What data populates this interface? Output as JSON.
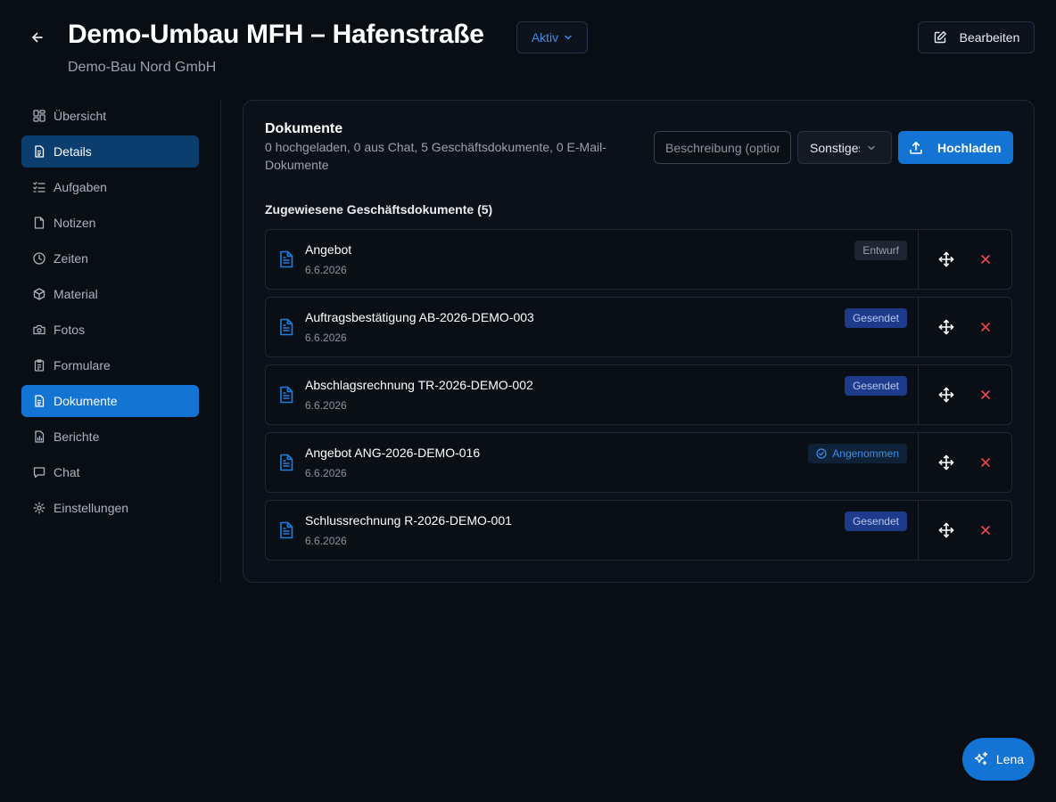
{
  "header": {
    "title": "Demo-Umbau MFH – Hafenstraße",
    "subtitle": "Demo-Bau Nord GmbH",
    "status_label": "Aktiv",
    "edit_label": "Bearbeiten"
  },
  "sidebar": {
    "items": [
      {
        "label": "Übersicht",
        "icon": "dashboard-icon"
      },
      {
        "label": "Details",
        "icon": "document-icon"
      },
      {
        "label": "Aufgaben",
        "icon": "checklist-icon"
      },
      {
        "label": "Notizen",
        "icon": "note-icon"
      },
      {
        "label": "Zeiten",
        "icon": "clock-icon"
      },
      {
        "label": "Material",
        "icon": "box-icon"
      },
      {
        "label": "Fotos",
        "icon": "camera-icon"
      },
      {
        "label": "Formulare",
        "icon": "clipboard-icon"
      },
      {
        "label": "Dokumente",
        "icon": "document-icon"
      },
      {
        "label": "Berichte",
        "icon": "report-icon"
      },
      {
        "label": "Chat",
        "icon": "chat-icon"
      },
      {
        "label": "Einstellungen",
        "icon": "gear-icon"
      }
    ],
    "hover_item": "Details",
    "active_item": "Dokumente"
  },
  "documents": {
    "title": "Dokumente",
    "summary": "0 hochgeladen, 0 aus Chat, 5 Geschäftsdokumente, 0 E-Mail-Dokumente",
    "description_placeholder": "Beschreibung (optional)",
    "type_selected": "Sonstiges",
    "upload_label": "Hochladen",
    "section_title": "Zugewiesene Geschäftsdokumente (5)",
    "items": [
      {
        "name": "Angebot",
        "date": "6.6.2026",
        "status": "Entwurf",
        "status_kind": "draft"
      },
      {
        "name": "Auftragsbestätigung AB-2026-DEMO-003",
        "date": "6.6.2026",
        "status": "Gesendet",
        "status_kind": "sent"
      },
      {
        "name": "Abschlagsrechnung TR-2026-DEMO-002",
        "date": "6.6.2026",
        "status": "Gesendet",
        "status_kind": "sent"
      },
      {
        "name": "Angebot ANG-2026-DEMO-016",
        "date": "6.6.2026",
        "status": "Angenommen",
        "status_kind": "accepted"
      },
      {
        "name": "Schlussrechnung R-2026-DEMO-001",
        "date": "6.6.2026",
        "status": "Gesendet",
        "status_kind": "sent"
      }
    ]
  },
  "assistant": {
    "label": "Lena"
  },
  "colors": {
    "background": "#090d14",
    "accent": "#1474d4",
    "danger": "#e5484d",
    "sent_badge": "#1e3a8a"
  }
}
